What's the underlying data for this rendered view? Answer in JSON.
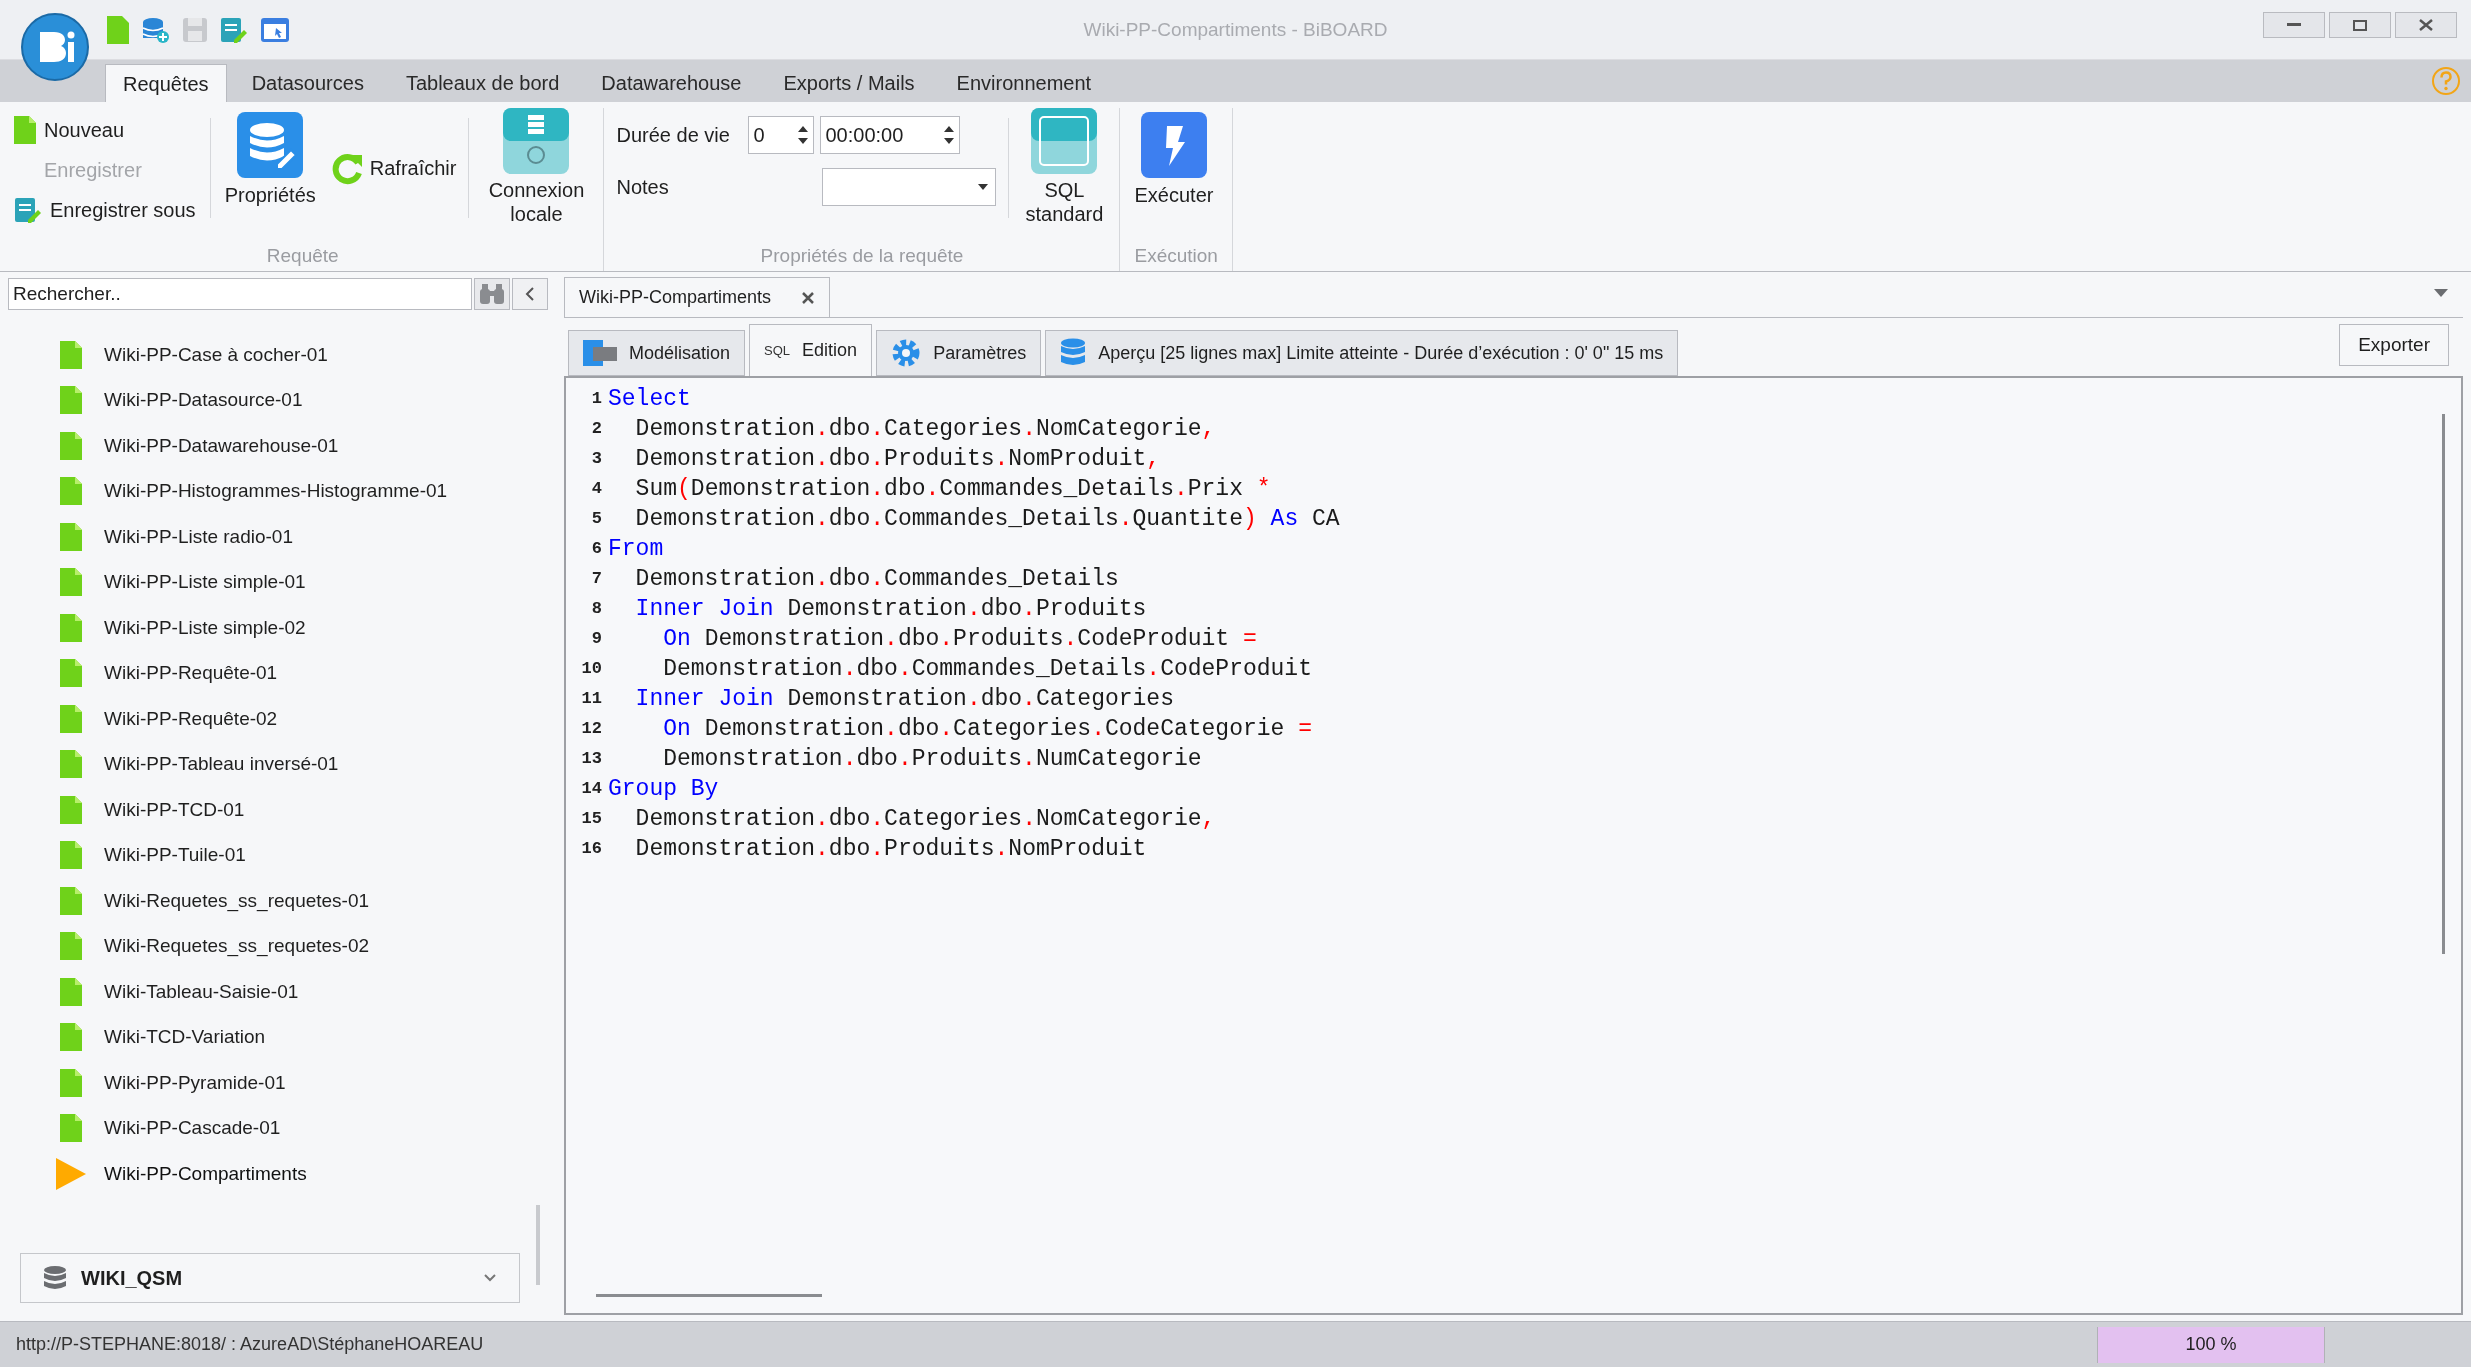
{
  "window": {
    "title": "Wiki-PP-Compartiments - BiBOARD"
  },
  "ribbon_tabs": [
    {
      "label": "Requêtes",
      "selected": true
    },
    {
      "label": "Datasources",
      "selected": false
    },
    {
      "label": "Tableaux de bord",
      "selected": false
    },
    {
      "label": "Datawarehouse",
      "selected": false
    },
    {
      "label": "Exports / Mails",
      "selected": false
    },
    {
      "label": "Environnement",
      "selected": false
    }
  ],
  "ribbon": {
    "request_group": {
      "label": "Requête",
      "new_button": {
        "label": "Nouveau",
        "disabled": false
      },
      "save_button": {
        "label": "Enregistrer",
        "disabled": true
      },
      "save_as_button": {
        "label": "Enregistrer sous",
        "disabled": false
      },
      "properties_button": "Propriétés",
      "refresh_button": "Rafraîchir",
      "local_connection_button": "Connexion locale"
    },
    "properties_group": {
      "label": "Propriétés de la requête",
      "lifetime_label": "Durée de vie",
      "lifetime_value": "0",
      "lifetime_time": "00:00:00",
      "notes_label": "Notes",
      "sql_button": "SQL standard"
    },
    "execution_group": {
      "label": "Exécution",
      "execute_button": "Exécuter"
    }
  },
  "sidebar": {
    "search": {
      "placeholder": "Rechercher.."
    },
    "items": [
      {
        "label": "Wiki-PP-Case à cocher-01",
        "selected": false
      },
      {
        "label": "Wiki-PP-Datasource-01",
        "selected": false
      },
      {
        "label": "Wiki-PP-Datawarehouse-01",
        "selected": false
      },
      {
        "label": "Wiki-PP-Histogrammes-Histogramme-01",
        "selected": false
      },
      {
        "label": "Wiki-PP-Liste radio-01",
        "selected": false
      },
      {
        "label": "Wiki-PP-Liste simple-01",
        "selected": false
      },
      {
        "label": "Wiki-PP-Liste simple-02",
        "selected": false
      },
      {
        "label": "Wiki-PP-Requête-01",
        "selected": false
      },
      {
        "label": "Wiki-PP-Requête-02",
        "selected": false
      },
      {
        "label": "Wiki-PP-Tableau inversé-01",
        "selected": false
      },
      {
        "label": "Wiki-PP-TCD-01",
        "selected": false
      },
      {
        "label": "Wiki-PP-Tuile-01",
        "selected": false
      },
      {
        "label": "Wiki-Requetes_ss_requetes-01",
        "selected": false
      },
      {
        "label": "Wiki-Requetes_ss_requetes-02",
        "selected": false
      },
      {
        "label": "Wiki-Tableau-Saisie-01",
        "selected": false
      },
      {
        "label": "Wiki-TCD-Variation",
        "selected": false
      },
      {
        "label": "Wiki-PP-Pyramide-01",
        "selected": false
      },
      {
        "label": "Wiki-PP-Cascade-01",
        "selected": false
      },
      {
        "label": "Wiki-PP-Compartiments",
        "selected": true
      }
    ],
    "database": "WIKI_QSM"
  },
  "document_tab": {
    "label": "Wiki-PP-Compartiments"
  },
  "editor_tabs": [
    {
      "label": "Modélisation",
      "selected": false
    },
    {
      "label": "Edition",
      "selected": true
    },
    {
      "label": "Paramètres",
      "selected": false
    },
    {
      "label": "Aperçu [25 lignes max] Limite atteinte - Durée d’exécution : 0' 0\" 15 ms",
      "selected": false
    }
  ],
  "editor_tab_badge": "SQL",
  "export_button": "Exporter",
  "code_lines": [
    {
      "number": "1",
      "tokens": [
        {
          "kind": "kw",
          "text": "Select"
        }
      ]
    },
    {
      "number": "2",
      "tokens": [
        {
          "kind": "id",
          "text": "  Demonstration"
        },
        {
          "kind": "member",
          "text": ".dbo"
        },
        {
          "kind": "member",
          "text": ".Categories"
        },
        {
          "kind": "member",
          "text": ".NomCategorie"
        },
        {
          "kind": "op",
          "text": ","
        }
      ]
    },
    {
      "number": "3",
      "tokens": [
        {
          "kind": "id",
          "text": "  Demonstration"
        },
        {
          "kind": "member",
          "text": ".dbo"
        },
        {
          "kind": "member",
          "text": ".Produits"
        },
        {
          "kind": "member",
          "text": ".NomProduit"
        },
        {
          "kind": "op",
          "text": ","
        }
      ]
    },
    {
      "number": "4",
      "tokens": [
        {
          "kind": "id",
          "text": "  Sum"
        },
        {
          "kind": "op",
          "text": "("
        },
        {
          "kind": "id",
          "text": "Demonstration"
        },
        {
          "kind": "member",
          "text": ".dbo"
        },
        {
          "kind": "member",
          "text": ".Commandes_Details"
        },
        {
          "kind": "member",
          "text": ".Prix "
        },
        {
          "kind": "op",
          "text": "*"
        }
      ]
    },
    {
      "number": "5",
      "tokens": [
        {
          "kind": "id",
          "text": "  Demonstration"
        },
        {
          "kind": "member",
          "text": ".dbo"
        },
        {
          "kind": "member",
          "text": ".Commandes_Details"
        },
        {
          "kind": "member",
          "text": ".Quantite"
        },
        {
          "kind": "op",
          "text": ")"
        },
        {
          "kind": "kw",
          "text": " As"
        },
        {
          "kind": "id",
          "text": " CA"
        }
      ]
    },
    {
      "number": "6",
      "tokens": [
        {
          "kind": "kw",
          "text": "From"
        }
      ]
    },
    {
      "number": "7",
      "tokens": [
        {
          "kind": "id",
          "text": "  Demonstration"
        },
        {
          "kind": "member",
          "text": ".dbo"
        },
        {
          "kind": "member",
          "text": ".Commandes_Details"
        }
      ]
    },
    {
      "number": "8",
      "tokens": [
        {
          "kind": "kw",
          "text": "  Inner Join"
        },
        {
          "kind": "id",
          "text": " Demonstration"
        },
        {
          "kind": "member",
          "text": ".dbo"
        },
        {
          "kind": "member",
          "text": ".Produits"
        }
      ]
    },
    {
      "number": "9",
      "tokens": [
        {
          "kind": "kw",
          "text": "    On"
        },
        {
          "kind": "id",
          "text": " Demonstration"
        },
        {
          "kind": "member",
          "text": ".dbo"
        },
        {
          "kind": "member",
          "text": ".Produits"
        },
        {
          "kind": "member",
          "text": ".CodeProduit "
        },
        {
          "kind": "op",
          "text": "="
        }
      ]
    },
    {
      "number": "10",
      "tokens": [
        {
          "kind": "id",
          "text": "    Demonstration"
        },
        {
          "kind": "member",
          "text": ".dbo"
        },
        {
          "kind": "member",
          "text": ".Commandes_Details"
        },
        {
          "kind": "member",
          "text": ".CodeProduit"
        }
      ]
    },
    {
      "number": "11",
      "tokens": [
        {
          "kind": "kw",
          "text": "  Inner Join"
        },
        {
          "kind": "id",
          "text": " Demonstration"
        },
        {
          "kind": "member",
          "text": ".dbo"
        },
        {
          "kind": "member",
          "text": ".Categories"
        }
      ]
    },
    {
      "number": "12",
      "tokens": [
        {
          "kind": "kw",
          "text": "    On"
        },
        {
          "kind": "id",
          "text": " Demonstration"
        },
        {
          "kind": "member",
          "text": ".dbo"
        },
        {
          "kind": "member",
          "text": ".Categories"
        },
        {
          "kind": "member",
          "text": ".CodeCategorie "
        },
        {
          "kind": "op",
          "text": "="
        }
      ]
    },
    {
      "number": "13",
      "tokens": [
        {
          "kind": "id",
          "text": "    Demonstration"
        },
        {
          "kind": "member",
          "text": ".dbo"
        },
        {
          "kind": "member",
          "text": ".Produits"
        },
        {
          "kind": "member",
          "text": ".NumCategorie"
        }
      ]
    },
    {
      "number": "14",
      "tokens": [
        {
          "kind": "kw",
          "text": "Group By"
        }
      ]
    },
    {
      "number": "15",
      "tokens": [
        {
          "kind": "id",
          "text": "  Demonstration"
        },
        {
          "kind": "member",
          "text": ".dbo"
        },
        {
          "kind": "member",
          "text": ".Categories"
        },
        {
          "kind": "member",
          "text": ".NomCategorie"
        },
        {
          "kind": "op",
          "text": ","
        }
      ]
    },
    {
      "number": "16",
      "tokens": [
        {
          "kind": "id",
          "text": "  Demonstration"
        },
        {
          "kind": "member",
          "text": ".dbo"
        },
        {
          "kind": "member",
          "text": ".Produits"
        },
        {
          "kind": "member",
          "text": ".NomProduit"
        }
      ]
    }
  ],
  "status_bar": {
    "connection": "http://P-STEPHANE:8018/ : AzureAD\\StéphaneHOAREAU",
    "zoom": {
      "label": "100 %",
      "level": 1
    }
  }
}
